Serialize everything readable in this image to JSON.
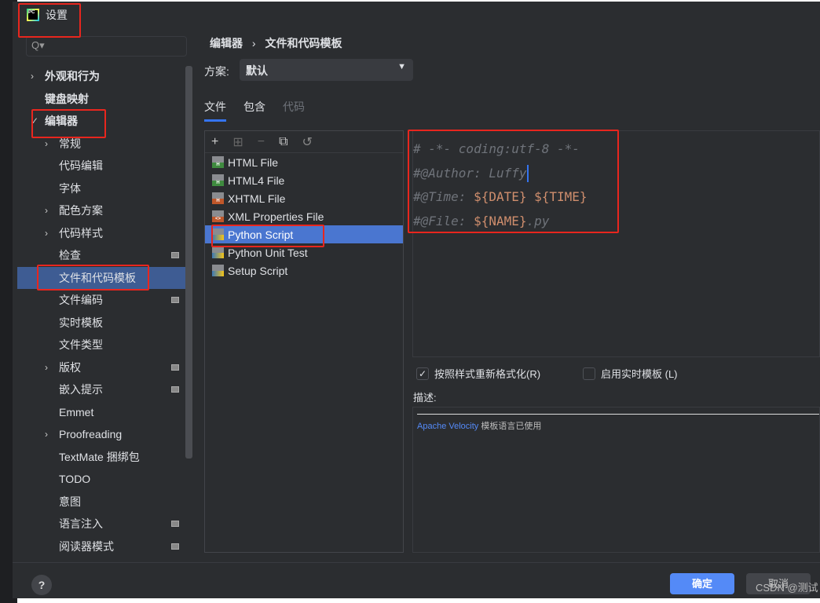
{
  "window": {
    "title": "设置",
    "logo_text": "PC"
  },
  "search": {
    "placeholder": "Q▾"
  },
  "sidebar": {
    "items": [
      {
        "label": "外观和行为",
        "level": 0,
        "chevron": "›",
        "bold": true
      },
      {
        "label": "键盘映射",
        "level": 0,
        "bold": true
      },
      {
        "label": "编辑器",
        "level": 0,
        "chevron": "✓",
        "bold": true
      },
      {
        "label": "常规",
        "level": 1,
        "chevron": "›"
      },
      {
        "label": "代码编辑",
        "level": 1
      },
      {
        "label": "字体",
        "level": 1
      },
      {
        "label": "配色方案",
        "level": 1,
        "chevron": "›"
      },
      {
        "label": "代码样式",
        "level": 1,
        "chevron": "›"
      },
      {
        "label": "检查",
        "level": 1,
        "icon": true
      },
      {
        "label": "文件和代码模板",
        "level": 1,
        "selected": true
      },
      {
        "label": "文件编码",
        "level": 1,
        "icon": true
      },
      {
        "label": "实时模板",
        "level": 1
      },
      {
        "label": "文件类型",
        "level": 1
      },
      {
        "label": "版权",
        "level": 1,
        "chevron": "›",
        "icon": true
      },
      {
        "label": "嵌入提示",
        "level": 1,
        "icon": true
      },
      {
        "label": "Emmet",
        "level": 1
      },
      {
        "label": "Proofreading",
        "level": 1,
        "chevron": "›"
      },
      {
        "label": "TextMate 捆绑包",
        "level": 1
      },
      {
        "label": "TODO",
        "level": 1
      },
      {
        "label": "意图",
        "level": 1
      },
      {
        "label": "语言注入",
        "level": 1,
        "icon": true
      },
      {
        "label": "阅读器模式",
        "level": 1,
        "icon": true
      }
    ]
  },
  "breadcrumb": {
    "parent": "编辑器",
    "sep": "›",
    "current": "文件和代码模板"
  },
  "scheme": {
    "label": "方案:",
    "value": "默认"
  },
  "tabs": [
    {
      "label": "文件",
      "active": true
    },
    {
      "label": "包含"
    },
    {
      "label": "代码",
      "disabled": true
    }
  ],
  "toolbar": {
    "add": "+",
    "add_child": "⊞",
    "remove": "−",
    "copy": "⧉",
    "reset": "↺"
  },
  "templates": [
    {
      "label": "HTML File",
      "badge": "H",
      "color": "#3f8b3f"
    },
    {
      "label": "HTML4 File",
      "badge": "H",
      "color": "#3f8b3f"
    },
    {
      "label": "XHTML File",
      "badge": "H",
      "color": "#c0572a"
    },
    {
      "label": "XML Properties File",
      "badge": "<>",
      "color": "#c0572a"
    },
    {
      "label": "Python Script",
      "badge": "py",
      "color": "#3b78b8",
      "selected": true
    },
    {
      "label": "Python Unit Test",
      "badge": "py",
      "color": "#3b78b8"
    },
    {
      "label": "Setup Script",
      "badge": "py",
      "color": "#3b78b8"
    }
  ],
  "editor": {
    "lines": [
      [
        {
          "t": "# -*- coding:utf-8 -*-",
          "c": "cm"
        }
      ],
      [
        {
          "t": "#@Author: Luffy",
          "c": "cm"
        }
      ],
      [
        {
          "t": "#@Time: ",
          "c": "cm"
        },
        {
          "t": "${DATE} ${TIME}",
          "c": "var"
        }
      ],
      [
        {
          "t": "#@File: ",
          "c": "cm"
        },
        {
          "t": "${NAME}",
          "c": "var"
        },
        {
          "t": ".py",
          "c": "cm"
        }
      ]
    ]
  },
  "options": {
    "reformat": {
      "label": "按照样式重新格式化(R)",
      "checked": true
    },
    "live_templates": {
      "label": "启用实时模板 (L)",
      "checked": false
    }
  },
  "description": {
    "label": "描述:",
    "link": "Apache Velocity",
    "text": "模板语言已使用"
  },
  "buttons": {
    "help": "?",
    "ok": "确定",
    "cancel": "取消"
  },
  "watermark": "CSDN @测试",
  "colors": {
    "accent": "#3574f0",
    "selection": "#4a76d0",
    "annotation": "#e8261e"
  }
}
